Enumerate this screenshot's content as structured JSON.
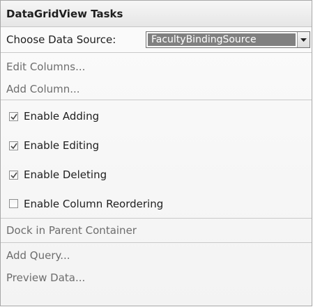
{
  "panel": {
    "title": "DataGridView Tasks"
  },
  "data_source": {
    "label": "Choose Data Source:",
    "selected": "FacultyBindingSource"
  },
  "links_top": [
    {
      "label": "Edit Columns..."
    },
    {
      "label": "Add Column..."
    }
  ],
  "options": [
    {
      "label": "Enable Adding",
      "checked": true
    },
    {
      "label": "Enable Editing",
      "checked": true
    },
    {
      "label": "Enable Deleting",
      "checked": true
    },
    {
      "label": "Enable Column Reordering",
      "checked": false
    }
  ],
  "dock": {
    "label": "Dock in Parent Container"
  },
  "links_bottom": [
    {
      "label": "Add Query..."
    },
    {
      "label": "Preview Data..."
    }
  ],
  "colors": {
    "link_disabled": "#6d6d6d",
    "selection": "#808080"
  }
}
